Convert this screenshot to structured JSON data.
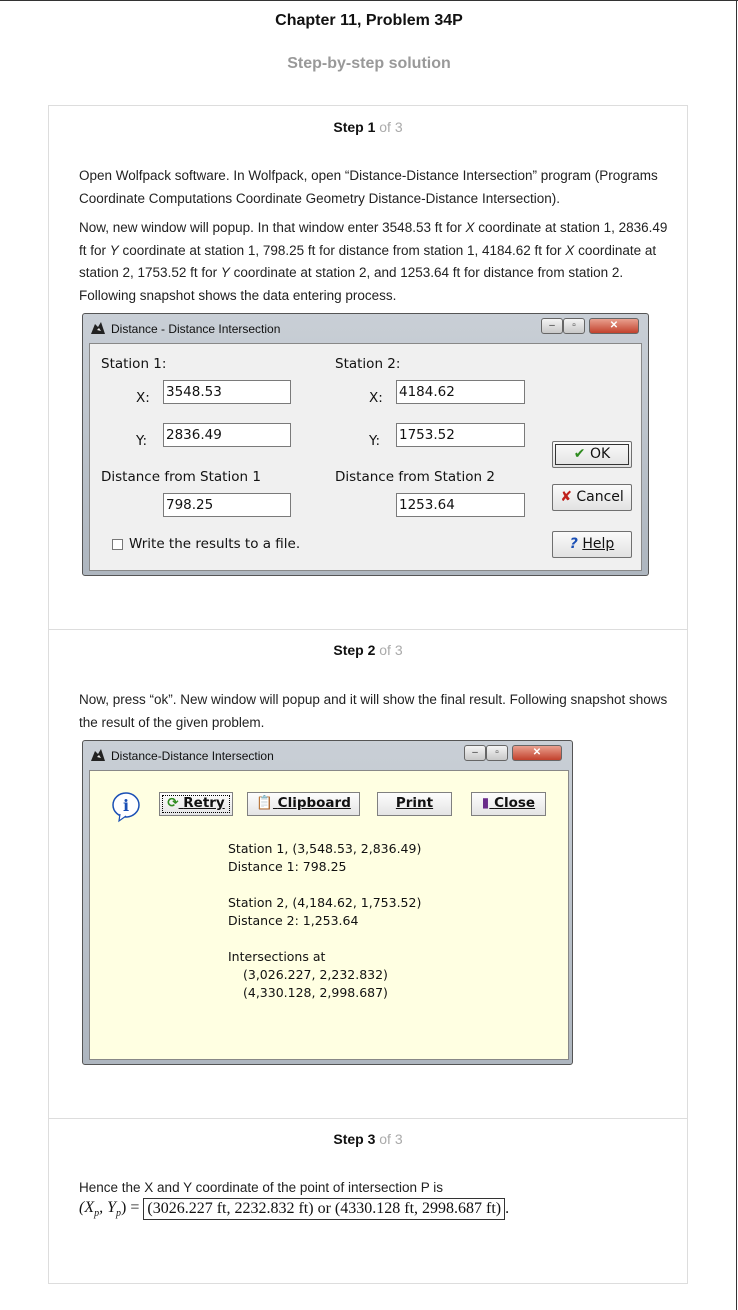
{
  "header": {
    "chapter_title": "Chapter 11, Problem 34P",
    "subtitle": "Step-by-step solution"
  },
  "steps": [
    {
      "label": "Step 1",
      "of": "of 3"
    },
    {
      "label": "Step 2",
      "of": "of 3"
    },
    {
      "label": "Step 3",
      "of": "of 3"
    }
  ],
  "step1": {
    "para1": "Open Wolfpack software. In Wolfpack, open “Distance-Distance Intersection” program (Programs Coordinate Computations Coordinate Geometry Distance-Distance Intersection).",
    "para2_parts": [
      "Now, new window will popup. In that window enter 3548.53 ft for ",
      "X",
      " coordinate at station 1, 2836.49 ft for ",
      "Y",
      " coordinate at station 1, 798.25 ft for distance from station 1, 4184.62 ft for ",
      "X",
      " coordinate at station 2, 1753.52 ft for ",
      "Y",
      " coordinate at station 2, and 1253.64 ft for distance from station 2. Following snapshot shows the data entering process."
    ],
    "dialog": {
      "title": "Distance - Distance Intersection",
      "station1_label": "Station 1:",
      "station2_label": "Station 2:",
      "x_label": "X:",
      "y_label": "Y:",
      "x1": "3548.53",
      "y1": "2836.49",
      "x2": "4184.62",
      "y2": "1753.52",
      "dist1_label": "Distance from Station 1",
      "dist2_label": "Distance from Station 2",
      "dist1": "798.25",
      "dist2": "1253.64",
      "checkbox_label": "Write the results to a file.",
      "ok": "OK",
      "cancel": "Cancel",
      "help": "Help"
    }
  },
  "step2": {
    "para": "Now, press “ok”. New window will popup and it will show the final result. Following snapshot shows the result of the given problem.",
    "dialog": {
      "title": "Distance-Distance Intersection",
      "retry": "Retry",
      "clipboard": "Clipboard",
      "print": "Print",
      "close": "Close",
      "results": [
        "Station 1, (3,548.53, 2,836.49)",
        "Distance 1: 798.25",
        "Station 2, (4,184.62, 1,753.52)",
        "Distance 2: 1,253.64",
        "Intersections at",
        "(3,026.227, 2,232.832)",
        "(4,330.128, 2,998.687)"
      ]
    }
  },
  "step3": {
    "para": "Hence the X and Y coordinate of the point of intersection P is",
    "lhs": "(X",
    "lhs_sub": "p",
    "lhs_mid": ", Y",
    "lhs_end": ") =",
    "answer": "(3026.227 ft, 2232.832 ft)  or  (4330.128 ft, 2998.687 ft)",
    "trail": "."
  },
  "colors": {
    "ok_check": "#2e8b1f",
    "cancel_x": "#c0211b",
    "help_q": "#1a4fb5",
    "result_bg": "#ffffe2"
  }
}
